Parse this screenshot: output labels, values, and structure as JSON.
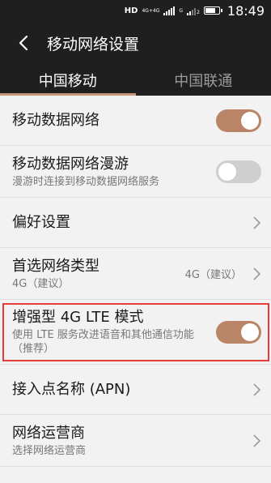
{
  "status_bar": {
    "network": "HD",
    "sim1_type": "4G+4G",
    "sim2_type": "G",
    "sim2_slot": "2",
    "time": "18:49"
  },
  "app_bar": {
    "back_icon": "back-arrow-icon",
    "title": "移动网络设置"
  },
  "tabs": [
    {
      "label": "中国移动",
      "active": true
    },
    {
      "label": "中国联通",
      "active": false
    }
  ],
  "settings": {
    "mobile_data": {
      "label": "移动数据网络",
      "enabled": true
    },
    "roaming": {
      "label": "移动数据网络漫游",
      "sub": "漫游时连接到移动数据网络服务",
      "enabled": false
    },
    "preferences": {
      "label": "偏好设置"
    },
    "network_type": {
      "label": "首选网络类型",
      "sub": "4G（建议）",
      "value": "4G（建议）"
    },
    "lte_mode": {
      "label": "增强型 4G LTE 模式",
      "sub": "使用 LTE 服务改进语音和其他通信功能（推荐）",
      "enabled": true
    },
    "apn": {
      "label": "接入点名称 (APN)"
    },
    "operator": {
      "label": "网络运营商",
      "sub": "选择网络运营商"
    }
  },
  "colors": {
    "accent": "#b98566",
    "bar_background": "#1f1f1f",
    "highlight_border": "#e53b3b"
  }
}
